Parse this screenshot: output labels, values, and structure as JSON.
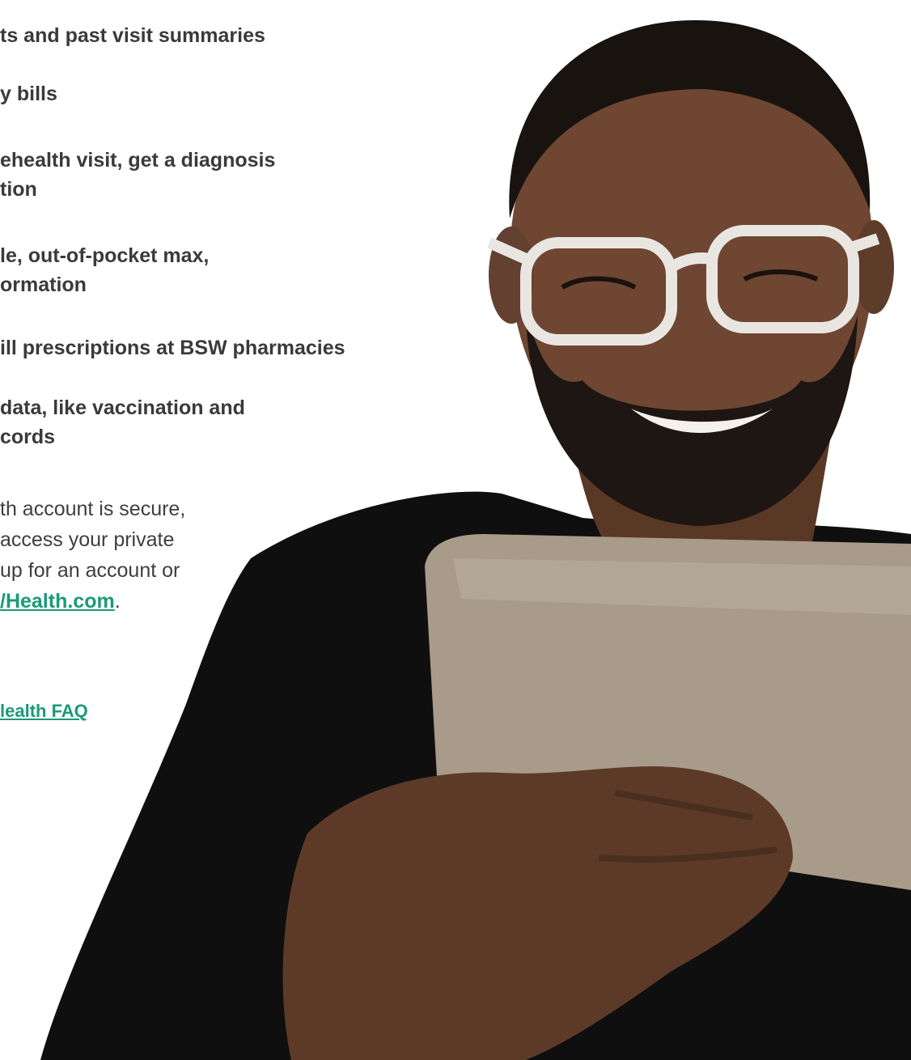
{
  "features": [
    {
      "lines": [
        "ts and past visit summaries"
      ]
    },
    {
      "lines": [
        "y bills"
      ]
    },
    {
      "lines": [
        "ehealth visit, get a diagnosis",
        "tion"
      ]
    },
    {
      "lines": [
        "le, out-of-pocket max,",
        "ormation"
      ]
    },
    {
      "lines": [
        "ill prescriptions at BSW pharmacies"
      ]
    },
    {
      "lines": [
        "data, like vaccination and",
        "cords"
      ]
    }
  ],
  "note": {
    "lines": [
      "th account is secure,",
      " access your private",
      " up for an account or"
    ],
    "link_text": "/Health.com",
    "trailing": "."
  },
  "faq_link": "lealth FAQ",
  "photo": {
    "subject": "man with glasses and beard smiling at tablet",
    "colors": {
      "skin": "#6b4530",
      "beard": "#1c1511",
      "shirt": "#0e0e0e",
      "tablet": "#a89a88",
      "glasses": "#e6e2de"
    }
  }
}
